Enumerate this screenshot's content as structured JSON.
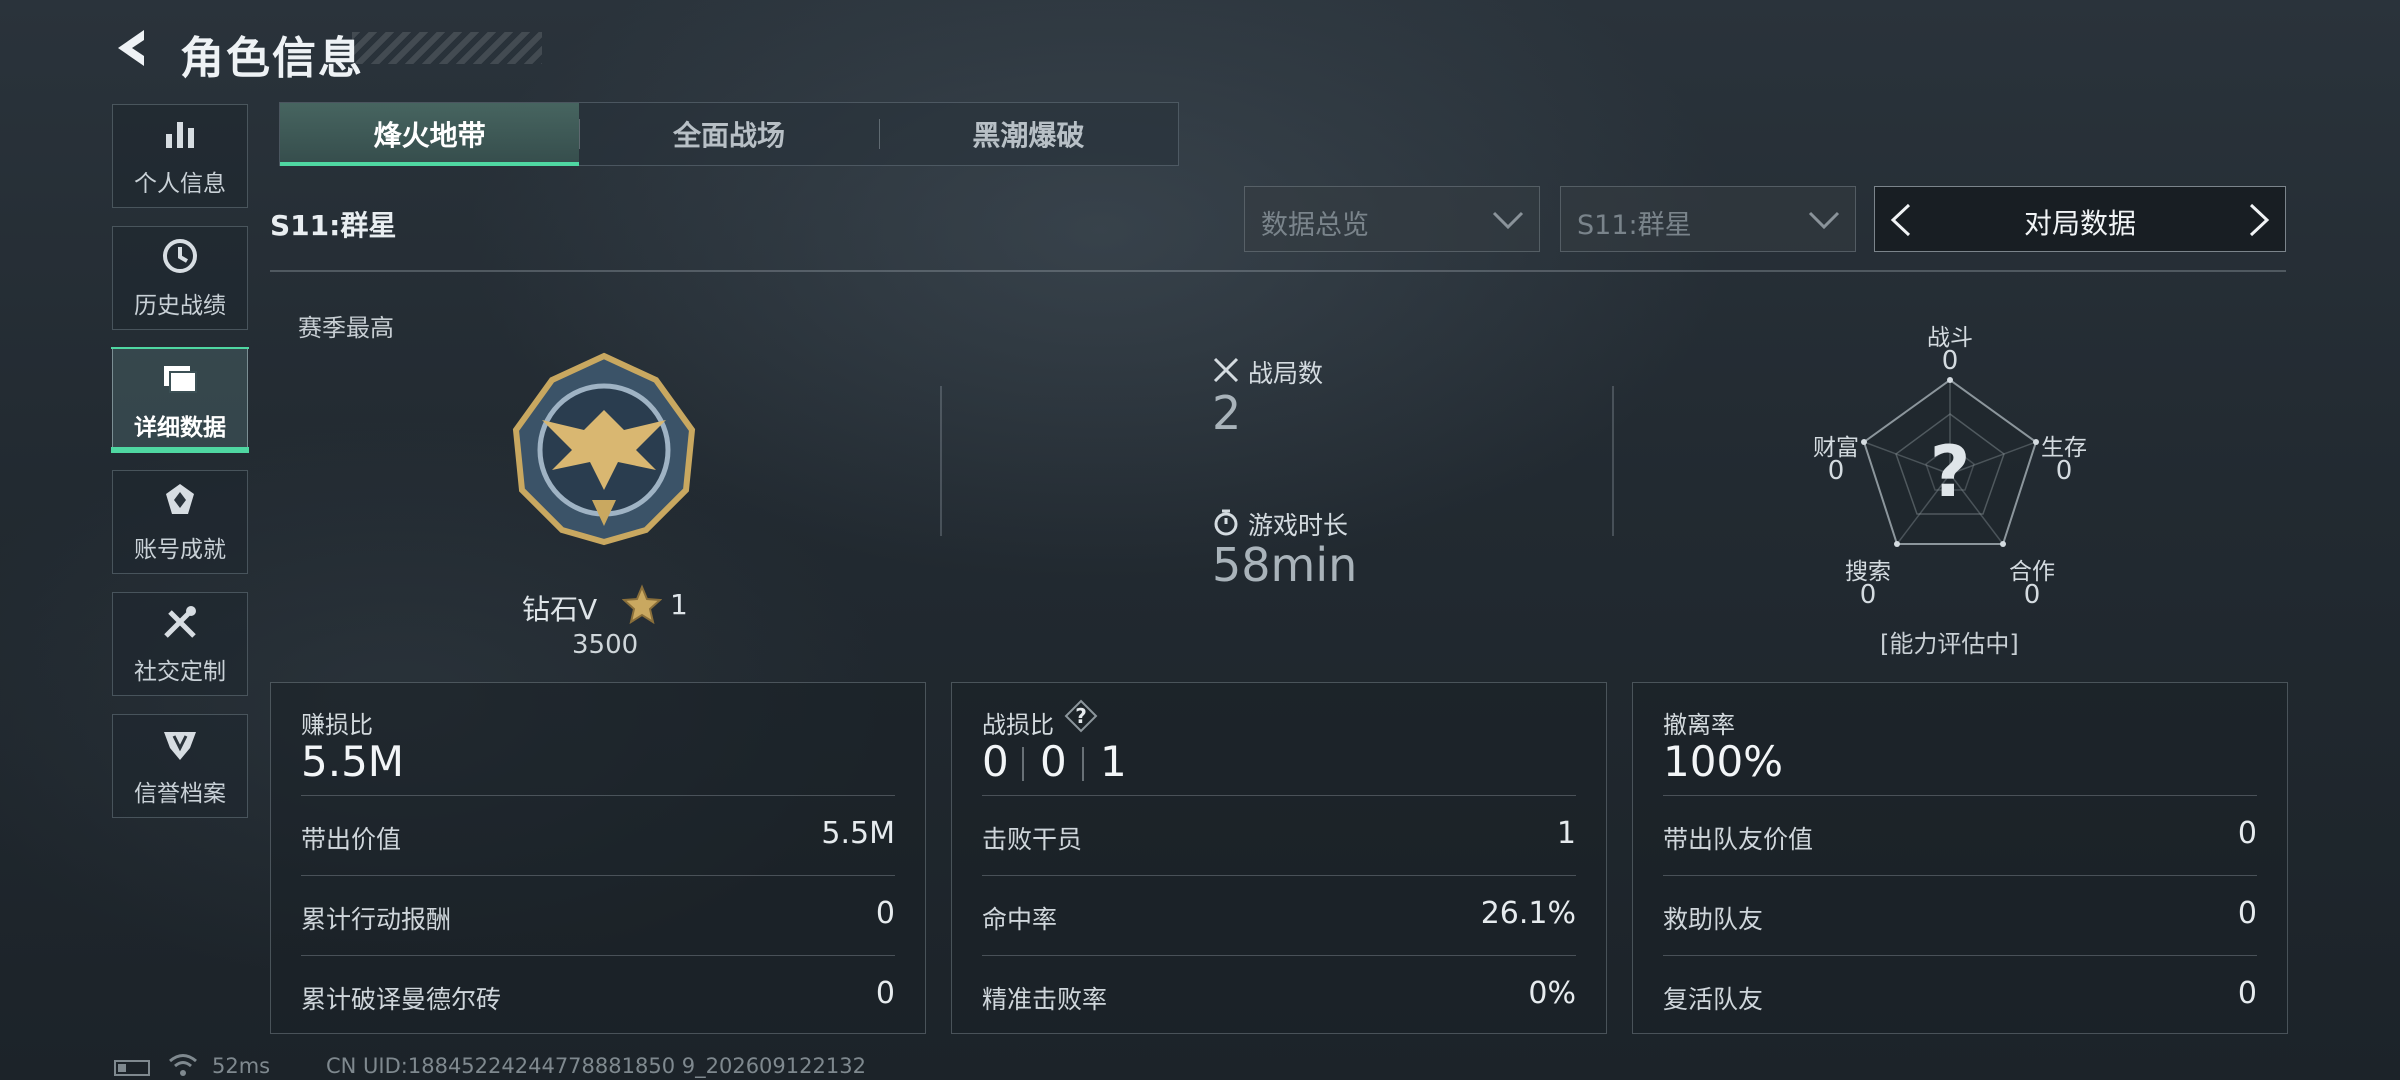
{
  "header": {
    "title": "角色信息",
    "back_icon": "chevron-left-icon"
  },
  "sidebar": {
    "items": [
      {
        "label": "个人信息",
        "icon": "bar-chart-icon",
        "active": false
      },
      {
        "label": "历史战绩",
        "icon": "clock-icon",
        "active": false
      },
      {
        "label": "详细数据",
        "icon": "folder-icon",
        "active": true
      },
      {
        "label": "账号成就",
        "icon": "achievement-icon",
        "active": false
      },
      {
        "label": "社交定制",
        "icon": "tools-icon",
        "active": false
      },
      {
        "label": "信誉档案",
        "icon": "shield-icon",
        "active": false
      }
    ]
  },
  "tabs": [
    {
      "label": "烽火地带",
      "active": true
    },
    {
      "label": "全面战场",
      "active": false
    },
    {
      "label": "黑潮爆破",
      "active": false
    }
  ],
  "season_title": "S11:群星",
  "filters": {
    "overview": "数据总览",
    "season": "S11:群星",
    "mode": "对局数据"
  },
  "rank": {
    "heading": "赛季最高",
    "name": "钻石V",
    "stars": "1",
    "score": "3500"
  },
  "match_stats": {
    "matches_label": "战局数",
    "matches_value": "2",
    "playtime_label": "游戏时长",
    "playtime_value": "58min"
  },
  "radar": {
    "center": "?",
    "status": "[能力评估中]",
    "axes": [
      {
        "label": "战斗",
        "value": "0"
      },
      {
        "label": "生存",
        "value": "0"
      },
      {
        "label": "合作",
        "value": "0"
      },
      {
        "label": "搜索",
        "value": "0"
      },
      {
        "label": "财富",
        "value": "0"
      }
    ]
  },
  "panels": {
    "profit": {
      "title": "赚损比",
      "value": "5.5M",
      "rows": [
        {
          "label": "带出价值",
          "value": "5.5M"
        },
        {
          "label": "累计行动报酬",
          "value": "0"
        },
        {
          "label": "累计破译曼德尔砖",
          "value": "0"
        }
      ]
    },
    "combat": {
      "title": "战损比",
      "help": "?",
      "kd": [
        "0",
        "0",
        "1"
      ],
      "rows": [
        {
          "label": "击败干员",
          "value": "1"
        },
        {
          "label": "命中率",
          "value": "26.1%"
        },
        {
          "label": "精准击败率",
          "value": "0%"
        }
      ]
    },
    "extract": {
      "title": "撤离率",
      "value": "100%",
      "rows": [
        {
          "label": "带出队友价值",
          "value": "0"
        },
        {
          "label": "救助队友",
          "value": "0"
        },
        {
          "label": "复活队友",
          "value": "0"
        }
      ]
    }
  },
  "footer": {
    "ping": "52ms",
    "uid": "CN UID:18845224244778881850 9_202609122132"
  },
  "colors": {
    "accent": "#4fd7a2",
    "background": "#232b32",
    "gold": "#c9a860"
  }
}
